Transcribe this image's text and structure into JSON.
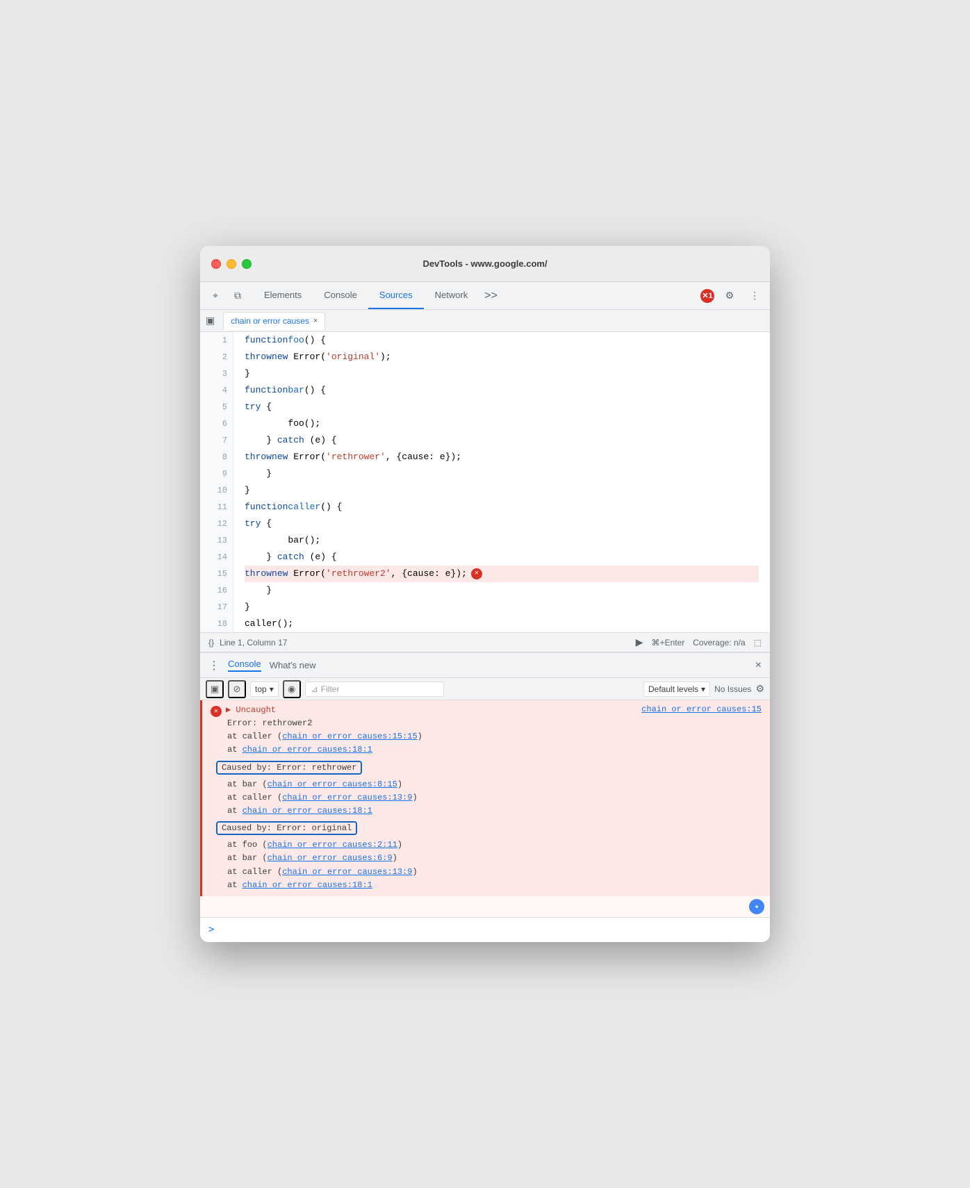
{
  "window": {
    "title": "DevTools - www.google.com/"
  },
  "devtools": {
    "tabs": [
      {
        "id": "elements",
        "label": "Elements",
        "active": false
      },
      {
        "id": "console",
        "label": "Console",
        "active": false
      },
      {
        "id": "sources",
        "label": "Sources",
        "active": true
      },
      {
        "id": "network",
        "label": "Network",
        "active": false
      }
    ],
    "more_tabs": ">>",
    "error_count": "1"
  },
  "file_tab": {
    "name": "chain or error causes",
    "close": "×"
  },
  "code": {
    "lines": [
      {
        "num": 1,
        "text": "function foo() {",
        "error": false
      },
      {
        "num": 2,
        "text": "    throw new Error('original');",
        "error": false
      },
      {
        "num": 3,
        "text": "}",
        "error": false
      },
      {
        "num": 4,
        "text": "function bar() {",
        "error": false
      },
      {
        "num": 5,
        "text": "    try {",
        "error": false
      },
      {
        "num": 6,
        "text": "        foo();",
        "error": false
      },
      {
        "num": 7,
        "text": "    } catch (e) {",
        "error": false
      },
      {
        "num": 8,
        "text": "        throw new Error('rethrower', {cause: e});",
        "error": false
      },
      {
        "num": 9,
        "text": "    }",
        "error": false
      },
      {
        "num": 10,
        "text": "}",
        "error": false
      },
      {
        "num": 11,
        "text": "function caller() {",
        "error": false
      },
      {
        "num": 12,
        "text": "    try {",
        "error": false
      },
      {
        "num": 13,
        "text": "        bar();",
        "error": false
      },
      {
        "num": 14,
        "text": "    } catch (e) {",
        "error": false
      },
      {
        "num": 15,
        "text": "        throw new Error('rethrower2', {cause: e});",
        "error": true
      },
      {
        "num": 16,
        "text": "    }",
        "error": false
      },
      {
        "num": 17,
        "text": "}",
        "error": false
      },
      {
        "num": 18,
        "text": "caller();",
        "error": false
      }
    ]
  },
  "status_bar": {
    "position": "Line 1, Column 17",
    "run_label": "▶",
    "shortcut": "⌘+Enter",
    "coverage": "Coverage: n/a"
  },
  "console": {
    "tab_active": "Console",
    "tab_inactive": "What's new",
    "toolbar": {
      "top_label": "top",
      "filter_placeholder": "Filter",
      "default_levels": "Default levels",
      "no_issues": "No Issues"
    },
    "error_block": {
      "header_text": "▶ Uncaught",
      "source_link": "chain or error causes:15",
      "error_type": "Error: rethrower2",
      "stack": [
        {
          "text": "    at caller (",
          "link": "chain or error causes:15:15",
          "suffix": ")"
        },
        {
          "text": "    at ",
          "link": "chain or error causes:18:1",
          "suffix": ""
        }
      ],
      "caused_by_1": {
        "label": "Caused by: Error: rethrower",
        "stack": [
          {
            "text": "    at bar (",
            "link": "chain or error causes:8:15",
            "suffix": ")"
          },
          {
            "text": "    at caller (",
            "link": "chain or error causes:13:9",
            "suffix": ")"
          },
          {
            "text": "    at ",
            "link": "chain or error causes:18:1",
            "suffix": ""
          }
        ]
      },
      "caused_by_2": {
        "label": "Caused by: Error: original",
        "stack": [
          {
            "text": "    at foo (",
            "link": "chain or error causes:2:11",
            "suffix": ")"
          },
          {
            "text": "    at bar (",
            "link": "chain or error causes:6:9",
            "suffix": ")"
          },
          {
            "text": "    at caller (",
            "link": "chain or error causes:13:9",
            "suffix": ")"
          },
          {
            "text": "    at ",
            "link": "chain or error causes:18:1",
            "suffix": ""
          }
        ]
      }
    }
  },
  "icons": {
    "cursor": "⌖",
    "layers": "⧉",
    "close": "×",
    "more_vert": "⋮",
    "sidebar_toggle": "▣",
    "ban": "⊘",
    "eye": "◉",
    "funnel": "⊿",
    "chevron_down": "▾",
    "gear": "⚙"
  }
}
